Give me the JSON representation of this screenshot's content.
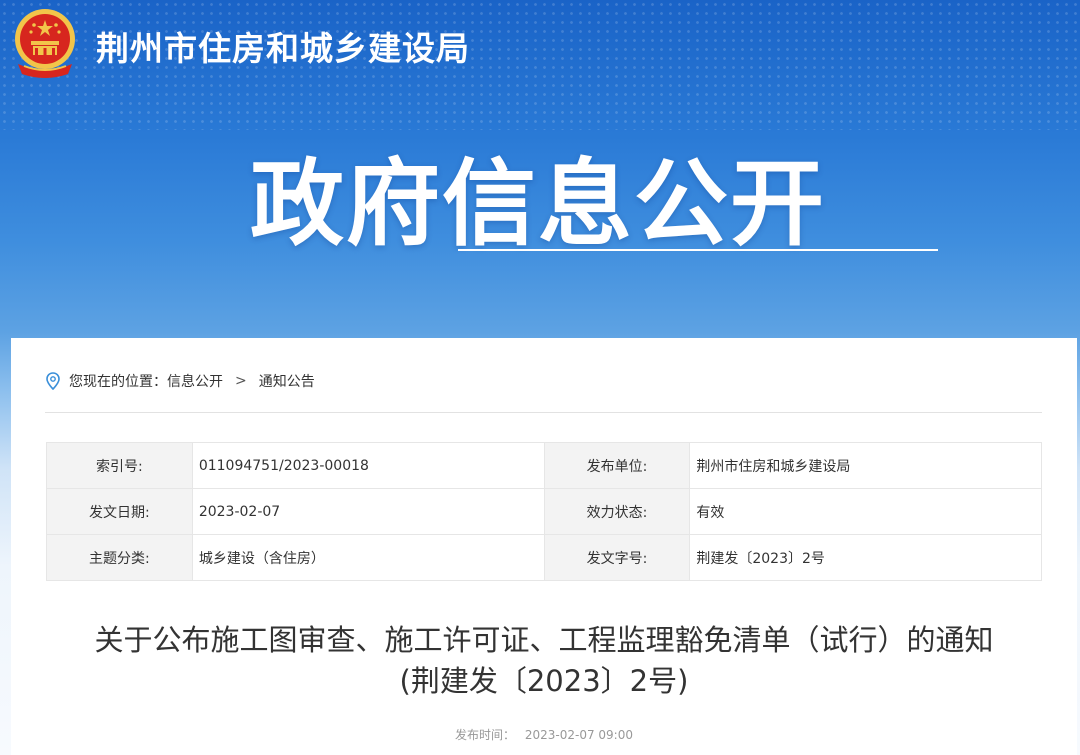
{
  "header": {
    "site_name": "荆州市住房和城乡建设局",
    "hero_title": "政府信息公开",
    "emblem_icon": "national-emblem-icon"
  },
  "breadcrumb": {
    "prefix": "您现在的位置：",
    "items": [
      "信息公开",
      "通知公告"
    ],
    "separator": ">",
    "icon": "location-pin-icon"
  },
  "meta": {
    "rows": [
      {
        "k1": "索引号:",
        "v1": "011094751/2023-00018",
        "k2": "发布单位:",
        "v2": "荆州市住房和城乡建设局"
      },
      {
        "k1": "发文日期:",
        "v1": "2023-02-07",
        "k2": "效力状态:",
        "v2": "有效"
      },
      {
        "k1": "主题分类:",
        "v1": "城乡建设（含住房）",
        "k2": "发文字号:",
        "v2": "荆建发〔2023〕2号"
      }
    ]
  },
  "article": {
    "title_line1": "关于公布施工图审查、施工许可证、工程监理豁免清单（试行）的通知",
    "title_line2": "(荆建发〔2023〕2号)",
    "publish_label": "发布时间：",
    "publish_time": "2023-02-07 09:00"
  },
  "colors": {
    "banner_blue": "#1a63c7",
    "emblem_red": "#d7261e",
    "emblem_gold": "#f2c54a",
    "accent": "#2a7ad6"
  }
}
